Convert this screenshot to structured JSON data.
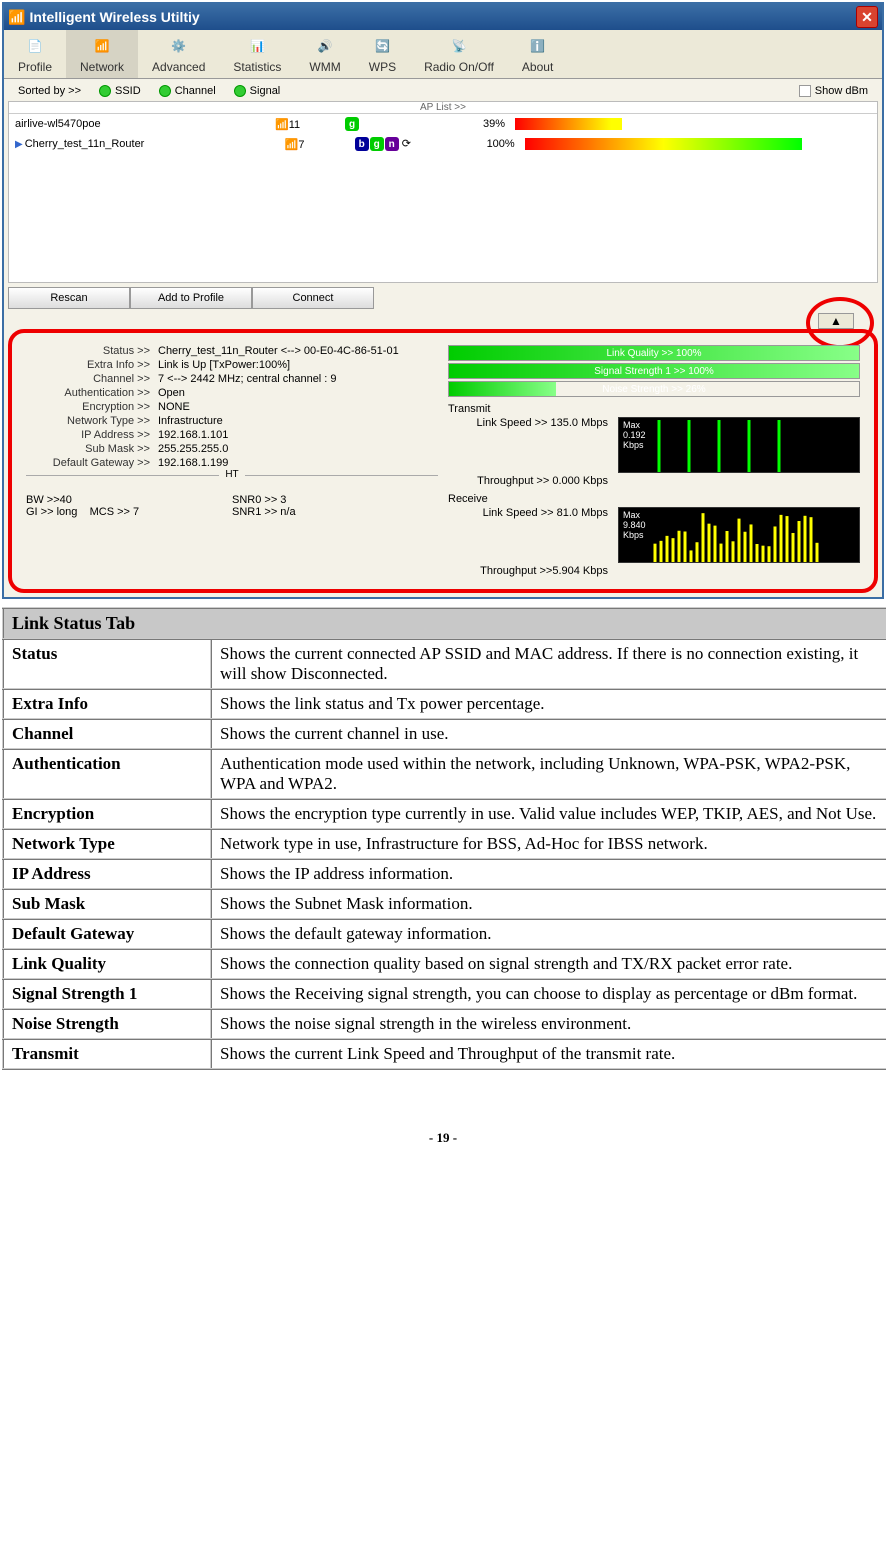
{
  "window": {
    "title": "Intelligent Wireless Utiltiy"
  },
  "toolbar": [
    "Profile",
    "Network",
    "Advanced",
    "Statistics",
    "WMM",
    "WPS",
    "Radio On/Off",
    "About"
  ],
  "sort": {
    "label": "Sorted by >>",
    "ssid": "SSID",
    "channel": "Channel",
    "signal": "Signal",
    "showdbm": "Show dBm"
  },
  "aplist": {
    "header": "AP List >>",
    "rows": [
      {
        "name": "airlive-wl5470poe",
        "ch": "11",
        "modes": [
          "g"
        ],
        "pct": "39%",
        "bar": "linear-gradient(90deg,#f00,#ff0 90%)",
        "barw": "30%",
        "sel": false
      },
      {
        "name": "Cherry_test_11n_Router",
        "ch": "7",
        "modes": [
          "b",
          "g",
          "n"
        ],
        "extra": "⟳",
        "pct": "100%",
        "bar": "linear-gradient(90deg,#f00,#ff0,#0f0)",
        "barw": "80%",
        "sel": true
      }
    ]
  },
  "buttons": {
    "rescan": "Rescan",
    "add": "Add to Profile",
    "connect": "Connect"
  },
  "status": {
    "kv": [
      [
        "Status >>",
        "Cherry_test_11n_Router <--> 00-E0-4C-86-51-01"
      ],
      [
        "Extra Info >>",
        "Link is Up [TxPower:100%]"
      ],
      [
        "Channel >>",
        "7 <--> 2442 MHz; central channel : 9"
      ],
      [
        "Authentication >>",
        "Open"
      ],
      [
        "Encryption >>",
        "NONE"
      ],
      [
        "Network Type >>",
        "Infrastructure"
      ],
      [
        "IP Address >>",
        "192.168.1.101"
      ],
      [
        "Sub Mask >>",
        "255.255.255.0"
      ],
      [
        "Default Gateway >>",
        "192.168.1.199"
      ]
    ],
    "ht": {
      "label": "HT",
      "bw": "BW >>40",
      "gi": "GI >> long",
      "mcs": "MCS >>  7",
      "snr0": "SNR0 >>  3",
      "snr1": "SNR1 >> n/a"
    },
    "meters": [
      {
        "label": "Link Quality >> 100%",
        "w": "100%",
        "c": "#4c4"
      },
      {
        "label": "Signal Strength 1 >> 100%",
        "w": "100%",
        "c": "#4c4"
      },
      {
        "label": "Noise Strength >> 26%",
        "w": "26%",
        "c": "#4c4"
      }
    ],
    "tx": {
      "title": "Transmit",
      "ls": "Link Speed >>  135.0 Mbps",
      "tp": "Throughput >> 0.000 Kbps",
      "max": "Max\n0.192\nKbps"
    },
    "rx": {
      "title": "Receive",
      "ls": "Link Speed >> 81.0 Mbps",
      "tp": "Throughput >>5.904 Kbps",
      "max": "Max\n9.840\nKbps"
    }
  },
  "doc": {
    "header": "Link Status Tab",
    "rows": [
      [
        "Status",
        "Shows the current connected AP SSID and MAC address. If there is no connection existing, it will show Disconnected."
      ],
      [
        "Extra Info",
        "Shows the link status and Tx power percentage."
      ],
      [
        "Channel",
        "Shows the current channel in use."
      ],
      [
        "Authentication",
        "Authentication mode used within the network, including Unknown, WPA-PSK, WPA2-PSK, WPA and WPA2."
      ],
      [
        "Encryption",
        "Shows the encryption type currently in use. Valid value includes WEP, TKIP, AES, and Not Use."
      ],
      [
        "Network Type",
        "Network type in use, Infrastructure for BSS, Ad-Hoc for IBSS network."
      ],
      [
        "IP Address",
        "Shows the IP address information."
      ],
      [
        "Sub Mask",
        "Shows the Subnet Mask information."
      ],
      [
        "Default Gateway",
        "Shows the default gateway information."
      ],
      [
        "Link Quality",
        "Shows the connection quality based on signal strength and TX/RX packet error rate."
      ],
      [
        "Signal Strength 1",
        "Shows the Receiving signal strength, you can choose to display as percentage or dBm format."
      ],
      [
        "Noise Strength",
        "Shows the noise signal strength in the wireless environment."
      ],
      [
        "Transmit",
        "Shows the current Link Speed and Throughput of the transmit rate."
      ]
    ]
  },
  "page": "- 19 -"
}
